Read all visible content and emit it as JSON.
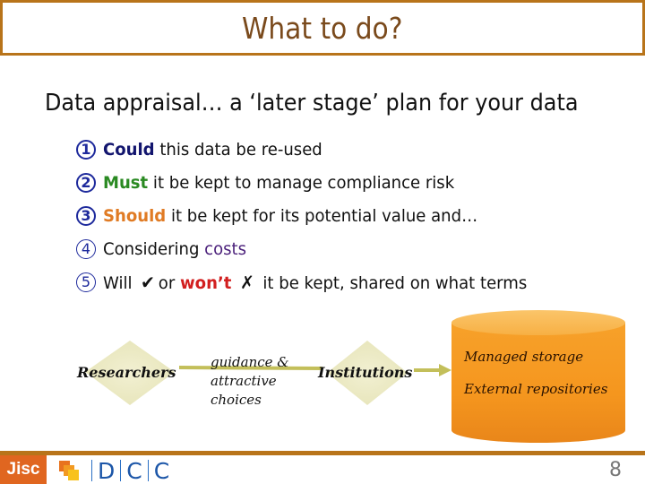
{
  "slide": {
    "title": "What to do?",
    "subtitle": "Data appraisal… a ‘later stage’ plan for your data",
    "items": [
      {
        "number": "1",
        "keyword": "Could",
        "rest": " this data be re-used"
      },
      {
        "number": "2",
        "keyword": "Must",
        "rest": " it be kept to manage compliance risk"
      },
      {
        "number": "3",
        "keyword": "Should",
        "rest": " it be kept for its potential value and…"
      },
      {
        "number": "4",
        "prefix": "Considering ",
        "keyword": "costs"
      },
      {
        "number": "5",
        "prefix": "Will",
        "check": "✔",
        "middle": "or",
        "keyword": "won’t",
        "cross": "✗",
        "rest": " it be kept, shared on what terms"
      }
    ],
    "colors": {
      "frame": "#b8741a",
      "could": "#12156e",
      "must": "#2a8a22",
      "should": "#e07b24",
      "costs": "#4a1f7a",
      "wont": "#d21f1f",
      "cylinder": "#f5961e",
      "diamond": "#ecebc4",
      "connector": "#c3bf5a"
    }
  },
  "diagram": {
    "node_researchers": "Researchers",
    "note_line1": "guidance &",
    "note_line2": "attractive",
    "note_line3": "choices",
    "node_institutions": "Institutions",
    "storage_line1": "Managed storage",
    "storage_line2": "External repositories"
  },
  "footer": {
    "jisc_label": "Jisc",
    "dcc_letters": [
      "D",
      "C",
      "C"
    ],
    "page_number": "8"
  }
}
